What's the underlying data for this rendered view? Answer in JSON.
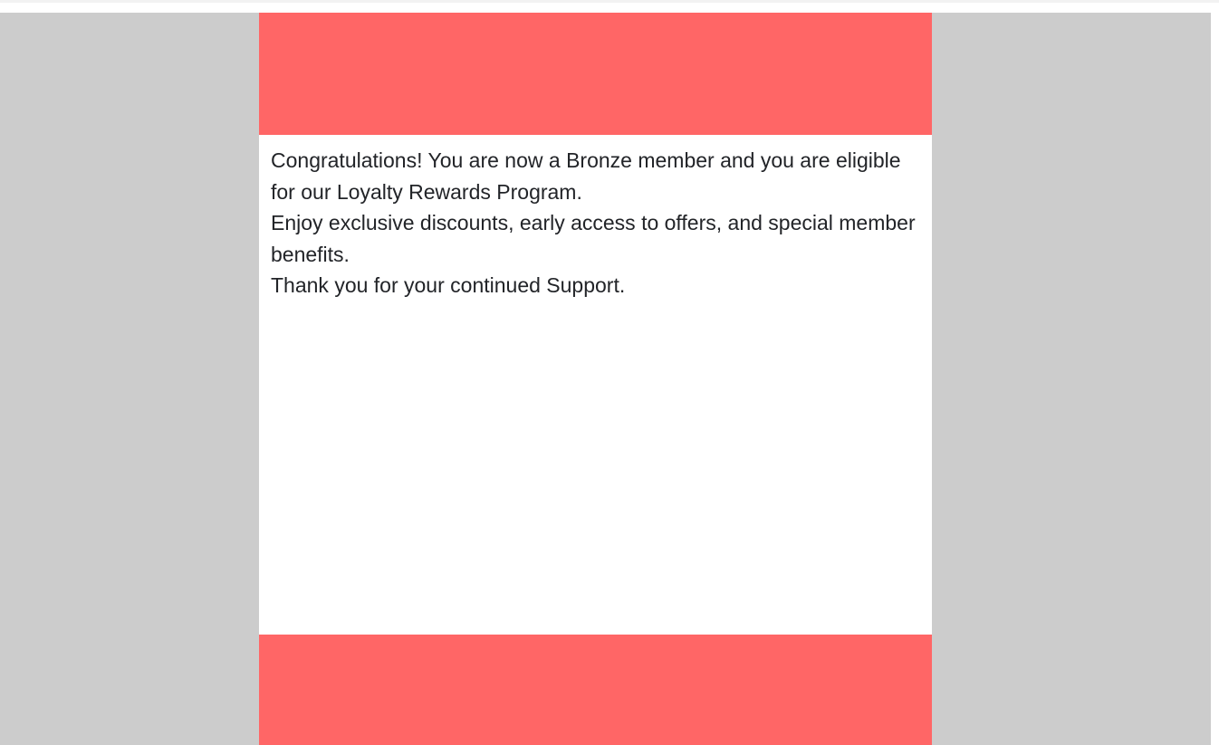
{
  "colors": {
    "page_background": "#cccccc",
    "card_background": "#ffffff",
    "banner": "#ff6666",
    "text": "#222428"
  },
  "email": {
    "message_lines": [
      "Congratulations! You are now a Bronze member and you are eligible for our Loyalty Rewards Program.",
      "Enjoy exclusive discounts, early access to offers, and special member benefits.",
      "Thank you for your continued Support."
    ]
  }
}
